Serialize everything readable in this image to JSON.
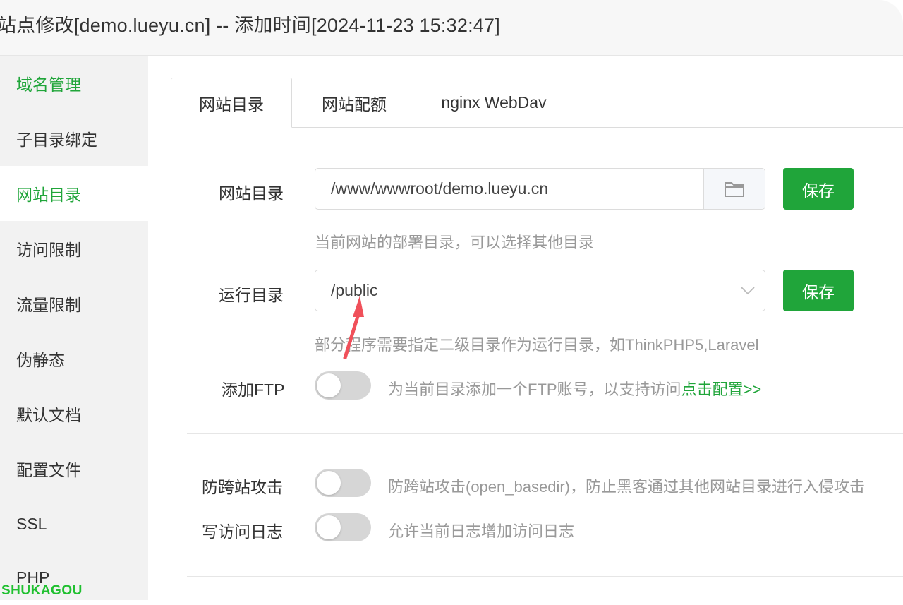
{
  "window": {
    "title": "站点修改[demo.lueyu.cn] -- 添加时间[2024-11-23 15:32:47]"
  },
  "sidebar": {
    "items": [
      {
        "label": "域名管理"
      },
      {
        "label": "子目录绑定"
      },
      {
        "label": "网站目录"
      },
      {
        "label": "访问限制"
      },
      {
        "label": "流量限制"
      },
      {
        "label": "伪静态"
      },
      {
        "label": "默认文档"
      },
      {
        "label": "配置文件"
      },
      {
        "label": "SSL"
      },
      {
        "label": "PHP"
      }
    ],
    "active_index": 2
  },
  "tabs": [
    {
      "label": "网站目录",
      "active": true
    },
    {
      "label": "网站配额",
      "active": false
    },
    {
      "label": "nginx WebDav",
      "active": false
    }
  ],
  "form": {
    "site_dir": {
      "label": "网站目录",
      "value": "/www/wwwroot/demo.lueyu.cn",
      "icon": "folder-icon",
      "save_label": "保存",
      "hint": "当前网站的部署目录，可以选择其他目录"
    },
    "run_dir": {
      "label": "运行目录",
      "value": "/public",
      "icon": "chevron-down-icon",
      "save_label": "保存",
      "hint": "部分程序需要指定二级目录作为运行目录，如ThinkPHP5,Laravel"
    },
    "ftp": {
      "label": "添加FTP",
      "enabled": false,
      "desc": "为当前目录添加一个FTP账号，以支持访问",
      "link": "点击配置>>"
    },
    "anti_xss": {
      "label": "防跨站攻击",
      "enabled": false,
      "desc": "防跨站攻击(open_basedir)，防止黑客通过其他网站目录进行入侵攻击"
    },
    "access_log": {
      "label": "写访问日志",
      "enabled": false,
      "desc": "允许当前日志增加访问日志"
    }
  },
  "watermark": "SHUKAGOU",
  "colors": {
    "accent": "#20a53a",
    "annotation_arrow": "#f0505a",
    "toggle_off": "#d6d6d6",
    "hint_text": "#999999"
  }
}
